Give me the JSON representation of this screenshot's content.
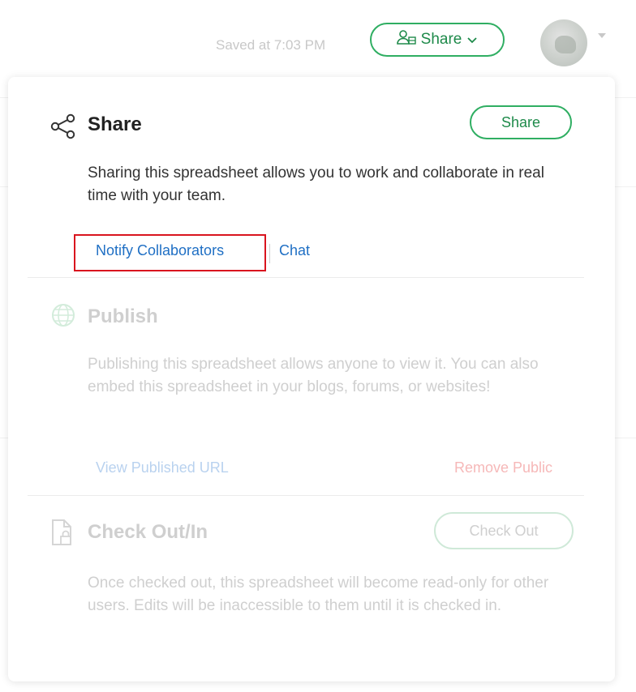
{
  "topbar": {
    "saved_text": "Saved at 7:03 PM",
    "share_button_label": "Share"
  },
  "share_section": {
    "title": "Share",
    "button_label": "Share",
    "description": "Sharing this spreadsheet allows you to work and collaborate in real time with your team.",
    "link_notify": "Notify Collaborators",
    "link_chat": "Chat"
  },
  "publish_section": {
    "title": "Publish",
    "description": "Publishing this spreadsheet allows anyone to view it. You can also embed this spreadsheet in your blogs, forums, or websites!",
    "link_view": "View Published URL",
    "link_remove": "Remove Public"
  },
  "checkout_section": {
    "title": "Check Out/In",
    "button_label": "Check Out",
    "description": "Once checked out, this spreadsheet will become read-only for other users. Edits will be inaccessible to them until it is checked in."
  },
  "colors": {
    "accent_green": "#2fae62",
    "link_blue": "#1f6fc4",
    "highlight_red": "#d9141e"
  },
  "icons": [
    "share-nodes-icon",
    "users-icon",
    "chevron-down-icon",
    "globe-icon",
    "lock-document-icon"
  ]
}
